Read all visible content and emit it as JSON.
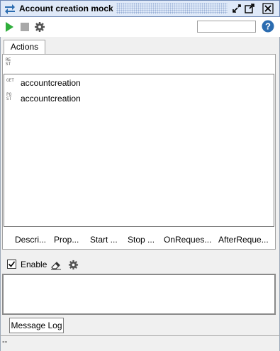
{
  "window": {
    "title": "Account creation mock"
  },
  "toolbar": {
    "run_icon": "play-icon",
    "stop_icon": "stop-icon",
    "settings_icon": "gear-icon",
    "search_value": "",
    "help_icon": "help-icon"
  },
  "tabs": [
    {
      "label": "Actions"
    }
  ],
  "panel": {
    "type_icon": "rest-icon",
    "items": [
      {
        "verb": "GET",
        "label": "accountcreation"
      },
      {
        "verb": "POST",
        "label": "accountcreation"
      }
    ],
    "bottom_tabs": [
      "Descri...",
      "Prop...",
      "Start ...",
      "Stop ...",
      "OnReques...",
      "AfterReque..."
    ]
  },
  "enable": {
    "label": "Enable",
    "checked": true
  },
  "message_log": {
    "tab_label": "Message Log"
  },
  "status": {
    "text": "--"
  },
  "colors": {
    "accent": "#2b6cb0",
    "play": "#2fae3b"
  }
}
